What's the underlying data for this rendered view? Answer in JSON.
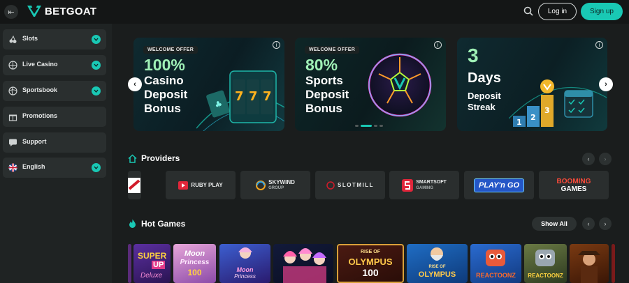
{
  "header": {
    "brand": "BETGOAT",
    "login_label": "Log in",
    "signup_label": "Sign up"
  },
  "sidebar": {
    "items": [
      {
        "label": "Slots",
        "icon": "cherries-icon",
        "expandable": true
      },
      {
        "label": "Live Casino",
        "icon": "roulette-icon",
        "expandable": true
      },
      {
        "label": "Sportsbook",
        "icon": "basketball-icon",
        "expandable": true
      },
      {
        "label": "Promotions",
        "icon": "gift-icon",
        "expandable": false
      },
      {
        "label": "Support",
        "icon": "chat-icon",
        "expandable": false
      },
      {
        "label": "English",
        "icon": "uk-flag-icon",
        "expandable": true
      }
    ]
  },
  "banners": [
    {
      "badge": "WELCOME OFFER",
      "percent": "100%",
      "lines": [
        "Casino",
        "Deposit",
        "Bonus"
      ]
    },
    {
      "badge": "WELCOME OFFER",
      "percent": "80%",
      "lines": [
        "Sports",
        "Deposit",
        "Bonus"
      ]
    },
    {
      "big": "3",
      "lines": [
        "Days"
      ],
      "sub": [
        "Deposit",
        "Streak"
      ]
    }
  ],
  "providers": {
    "title": "Providers",
    "items": [
      "RUBY PLAY",
      "SKYWIND",
      "GROUP",
      "SLOTMILL",
      "SMARTSOFT",
      "GAMING",
      "PLAY'n GO",
      "BOOMING",
      "GAMES"
    ]
  },
  "hot_games": {
    "title": "Hot Games",
    "show_all_label": "Show All",
    "tiles": [
      "SUPER",
      "UP",
      "Deluxe",
      "Moon",
      "Princess",
      "100",
      "Moon",
      "Princess",
      "RISE OF",
      "OLYMPUS",
      "100",
      "RISE OF",
      "OLYMPUS",
      "REACTOONZ",
      "REACTOONZ"
    ]
  },
  "colors": {
    "accent": "#19c8b4",
    "background": "#1a1d1d",
    "sidebar": "#1f2323",
    "card": "#2a2e2e"
  }
}
